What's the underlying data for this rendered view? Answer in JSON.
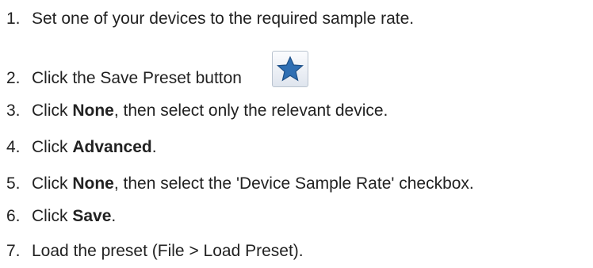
{
  "steps": [
    {
      "num": "1.",
      "pre": "Set one of your devices to the required sample rate.",
      "bold": "",
      "post": ""
    },
    {
      "num": "2.",
      "pre": "Click the Save Preset button",
      "bold": "",
      "post": "",
      "icon": "star-icon"
    },
    {
      "num": "3.",
      "pre": "Click ",
      "bold": "None",
      "post": ", then select only the relevant device."
    },
    {
      "num": "4.",
      "pre": "Click ",
      "bold": "Advanced",
      "post": "."
    },
    {
      "num": "5.",
      "pre": "Click ",
      "bold": "None",
      "post": ", then select the 'Device Sample Rate' checkbox."
    },
    {
      "num": "6.",
      "pre": "Click ",
      "bold": "Save",
      "post": "."
    },
    {
      "num": "7.",
      "pre": "Load the preset (File > Load Preset).",
      "bold": "",
      "post": ""
    }
  ],
  "colors": {
    "text": "#222222",
    "star": "#2f6fb3"
  }
}
